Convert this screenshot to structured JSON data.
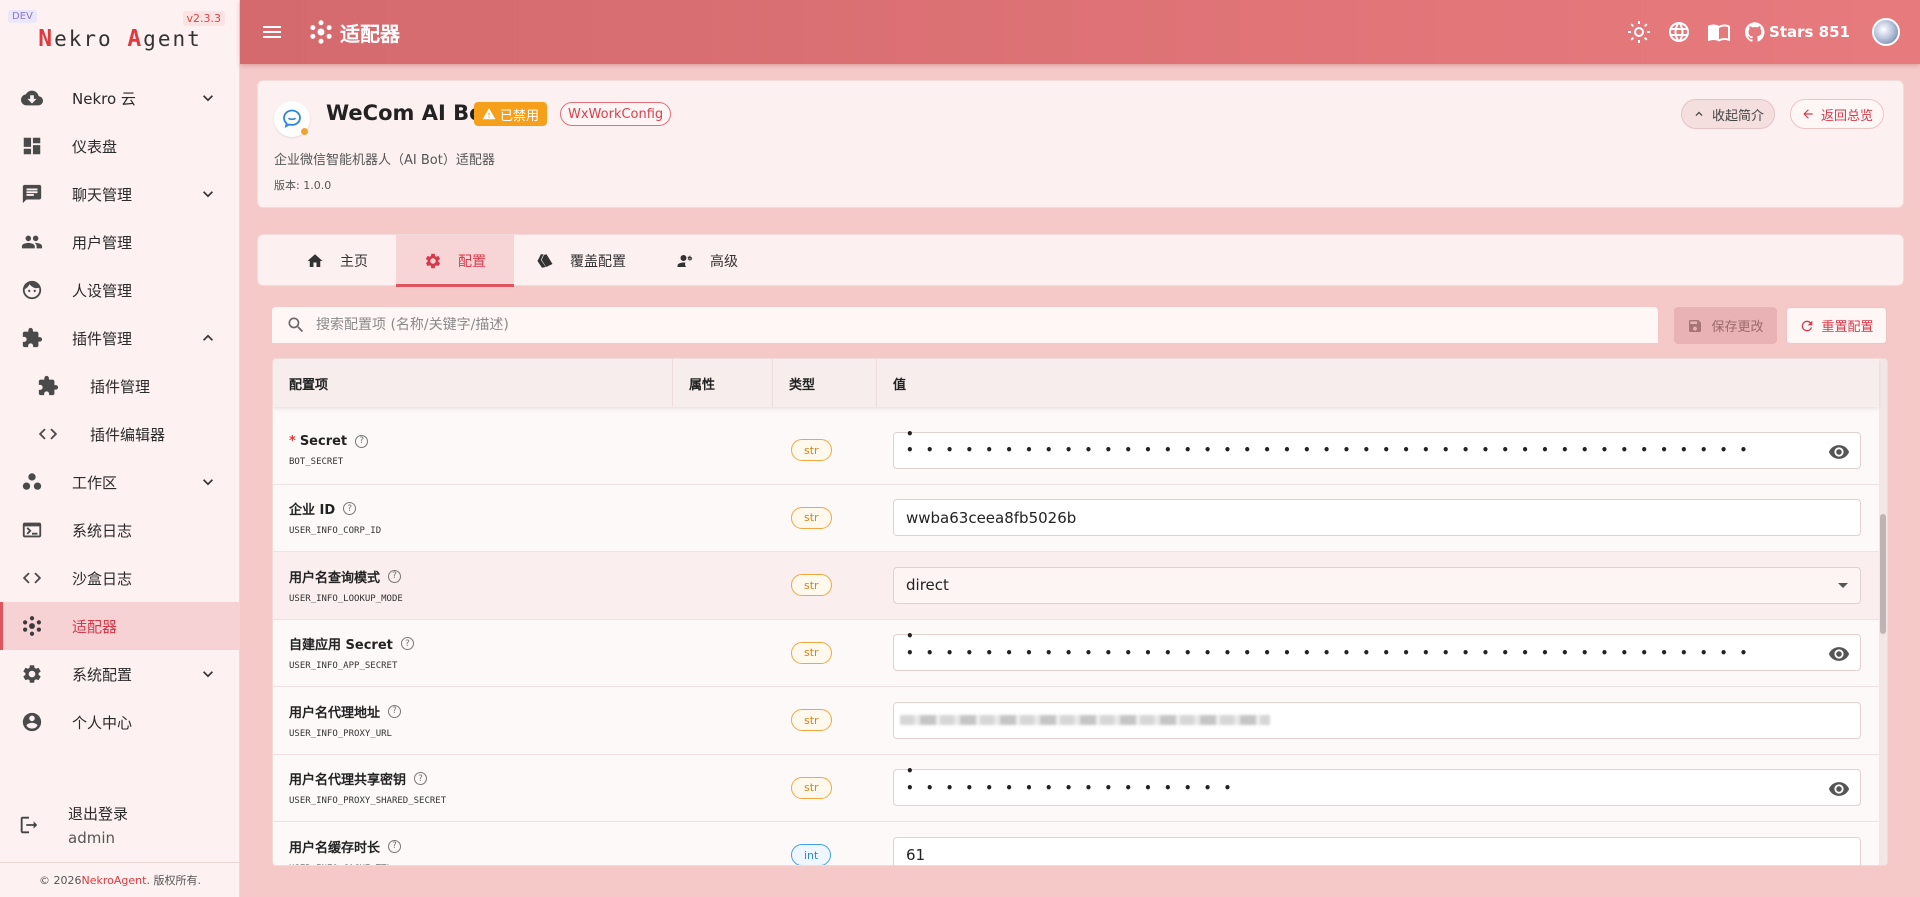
{
  "sidebar": {
    "dev_badge": "DEV",
    "version": "v2.3.3",
    "logo": {
      "n": "N",
      "ekro": "ekro ",
      "a": "A",
      "gent": "gent"
    },
    "items": [
      {
        "label": "Nekro 云",
        "icon": "cloud-download-icon",
        "expandable": true
      },
      {
        "label": "仪表盘",
        "icon": "dashboard-icon"
      },
      {
        "label": "聊天管理",
        "icon": "chat-icon",
        "expandable": true
      },
      {
        "label": "用户管理",
        "icon": "users-icon"
      },
      {
        "label": "人设管理",
        "icon": "face-icon"
      },
      {
        "label": "插件管理",
        "icon": "puzzle-icon",
        "expanded": true
      },
      {
        "label": "插件管理",
        "icon": "puzzle-icon",
        "sub": true
      },
      {
        "label": "插件编辑器",
        "icon": "code-icon",
        "sub": true
      },
      {
        "label": "工作区",
        "icon": "workspace-icon",
        "expandable": true
      },
      {
        "label": "系统日志",
        "icon": "terminal-icon"
      },
      {
        "label": "沙盒日志",
        "icon": "code-icon"
      },
      {
        "label": "适配器",
        "icon": "hub-icon",
        "active": true
      },
      {
        "label": "系统配置",
        "icon": "gear-icon",
        "expandable": true
      },
      {
        "label": "个人中心",
        "icon": "account-icon"
      }
    ],
    "logout_label": "退出登录",
    "username": "admin",
    "copyright_prefix": "© 2026 ",
    "copyright_brand": "NekroAgent",
    "copyright_suffix": ". 版权所有."
  },
  "topbar": {
    "title": "适配器",
    "stars_label": "Stars 851"
  },
  "header": {
    "name": "WeCom AI Bot",
    "status_badge": "已禁用",
    "config_badge": "WxWorkConfig",
    "description": "企业微信智能机器人（AI Bot）适配器",
    "version": "版本: 1.0.0",
    "collapse_label": "收起简介",
    "back_label": "返回总览"
  },
  "tabs": [
    {
      "label": "主页",
      "icon": "home-icon"
    },
    {
      "label": "配置",
      "icon": "gear-icon",
      "active": true
    },
    {
      "label": "覆盖配置",
      "icon": "cards-icon"
    },
    {
      "label": "高级",
      "icon": "user-gear-icon"
    }
  ],
  "toolbar": {
    "search_placeholder": "搜索配置项 (名称/关键字/描述)",
    "save_label": "保存更改",
    "reset_label": "重置配置"
  },
  "table": {
    "headers": [
      "配置项",
      "属性",
      "类型",
      "值"
    ],
    "rows": [
      {
        "name": "Secret",
        "required": true,
        "key": "BOT_SECRET",
        "type": "str",
        "value": "• • • • • • • • • • • • • • • • • • • • • • • • • • • • • • • • • • • • • • • • • • •",
        "kind": "password"
      },
      {
        "name": "企业 ID",
        "key": "USER_INFO_CORP_ID",
        "type": "str",
        "value": "wwba63ceea8fb5026b",
        "kind": "text"
      },
      {
        "name": "用户名查询模式",
        "key": "USER_INFO_LOOKUP_MODE",
        "type": "str",
        "value": "direct",
        "kind": "select"
      },
      {
        "name": "自建应用 Secret",
        "key": "USER_INFO_APP_SECRET",
        "type": "str",
        "value": "• • • • • • • • • • • • • • • • • • • • • • • • • • • • • • • • • • • • • • • • • • •",
        "kind": "password"
      },
      {
        "name": "用户名代理地址",
        "key": "USER_INFO_PROXY_URL",
        "type": "str",
        "value": "",
        "kind": "blurred"
      },
      {
        "name": "用户名代理共享密钥",
        "key": "USER_INFO_PROXY_SHARED_SECRET",
        "type": "str",
        "value": "• • • • • • • • • • • • • • • • •",
        "kind": "password"
      },
      {
        "name": "用户名缓存时长",
        "key": "USER_INFO_CACHE_TTL",
        "type": "int",
        "value": "61",
        "kind": "text"
      }
    ]
  }
}
